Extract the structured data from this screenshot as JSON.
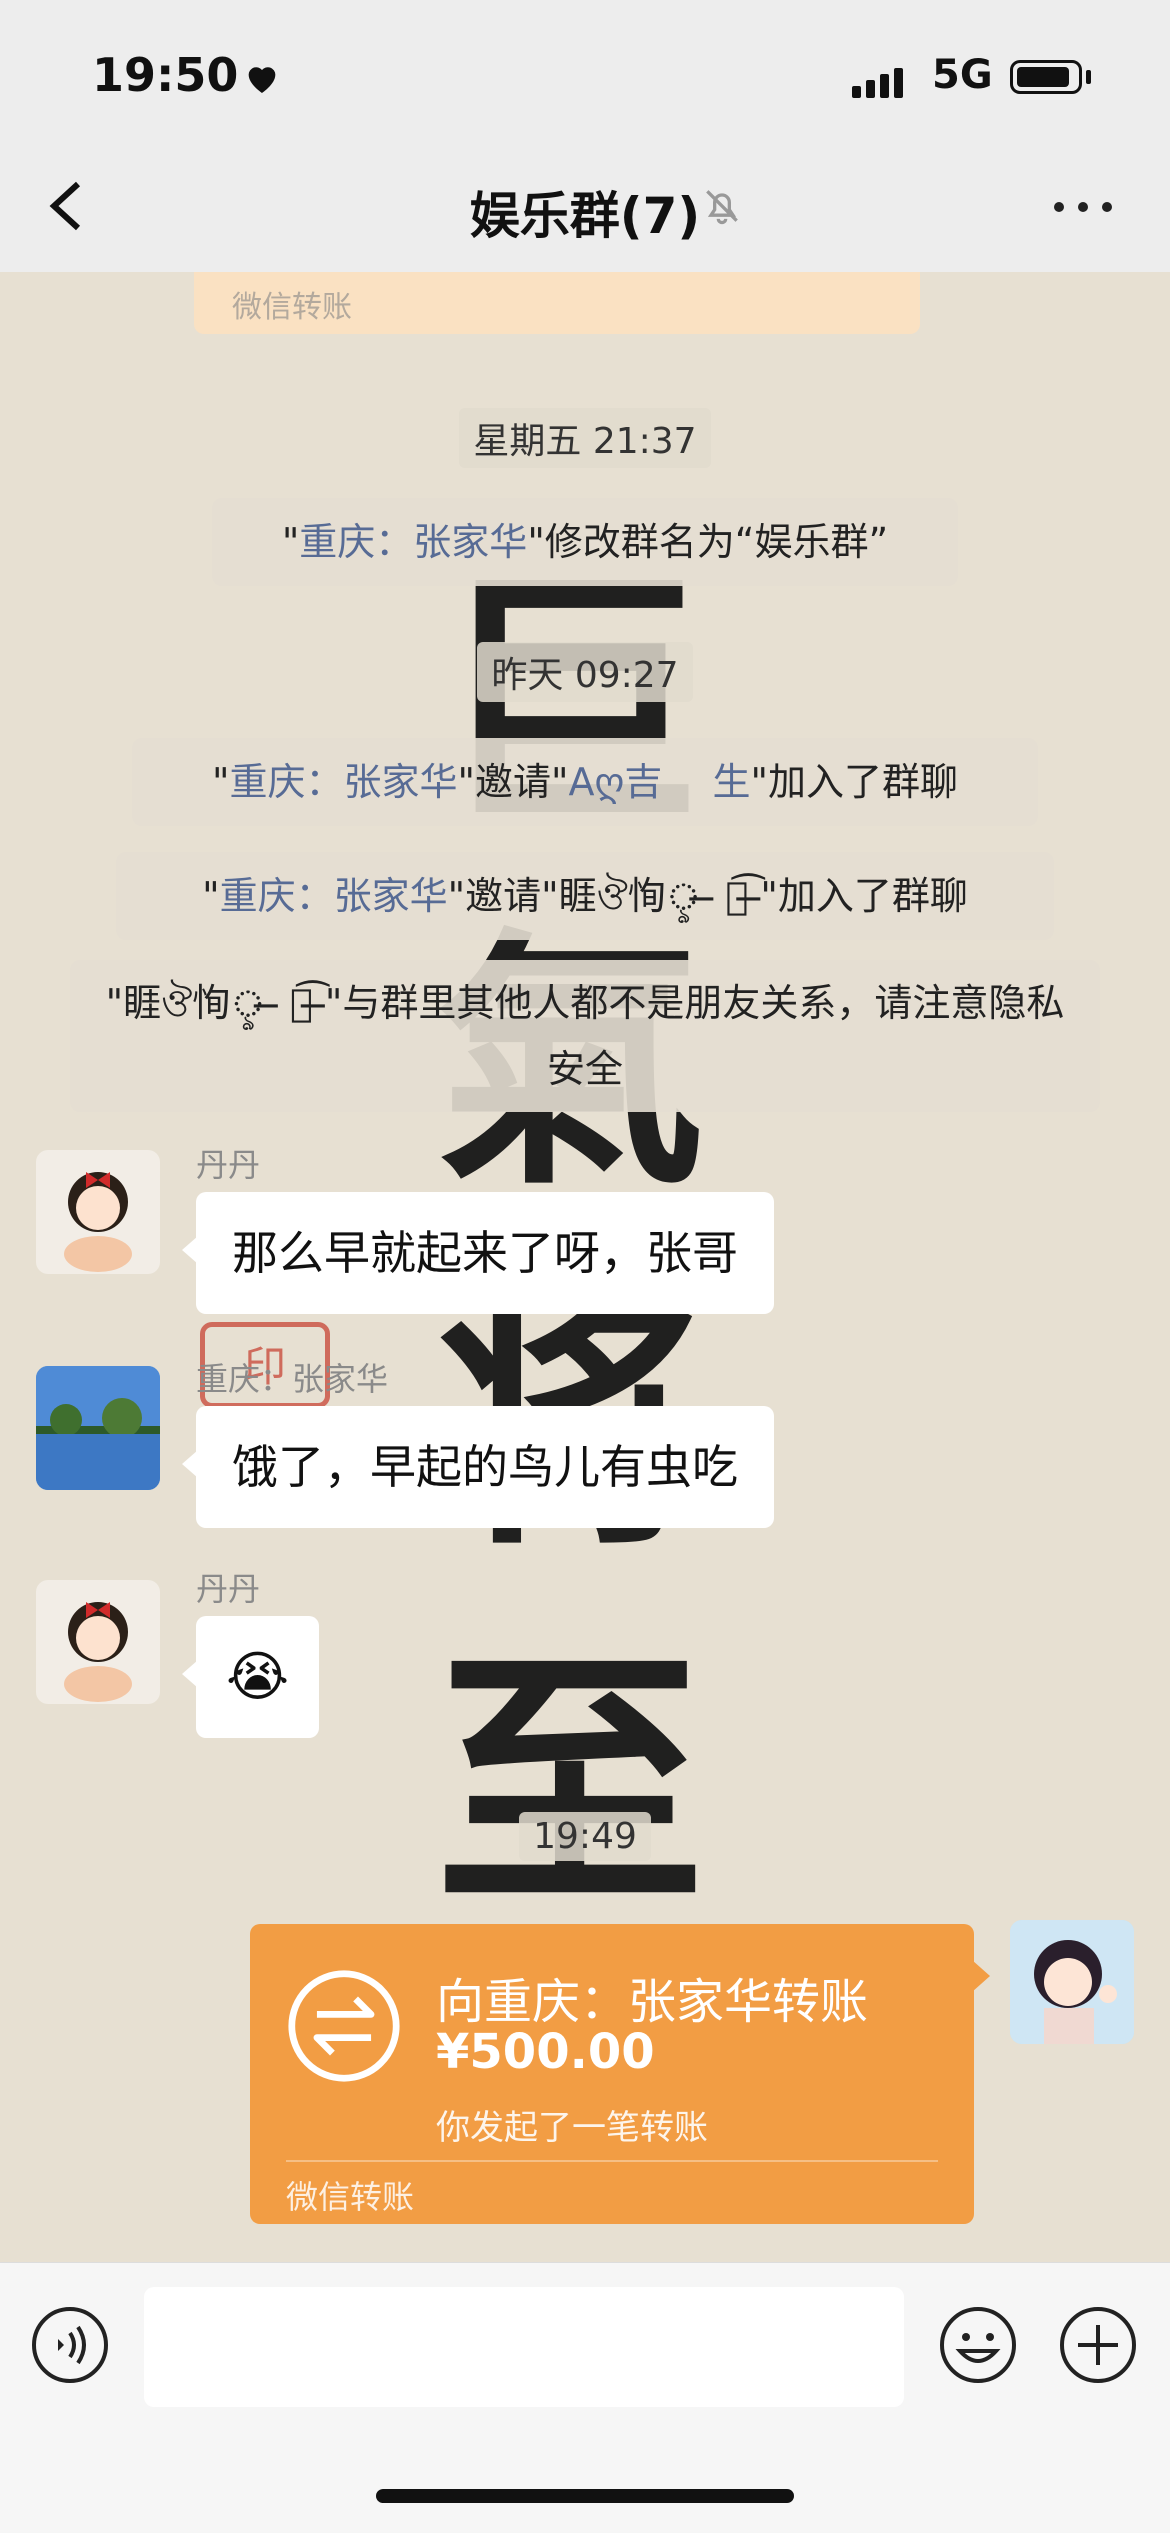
{
  "status": {
    "time": "19:50",
    "network": "5G"
  },
  "nav": {
    "title": "娱乐群(7)"
  },
  "chat": {
    "peek_label": "微信转账",
    "ts1": "星期五 21:37",
    "sys1": {
      "q1": "\"",
      "name": "重庆：张家华",
      "q2": "\"",
      "text": "修改群名为“娱乐群”"
    },
    "ts2": "昨天 09:27",
    "sys2": {
      "q1": "\"",
      "inviter": "重庆：张家华",
      "mid": "\"邀请\"",
      "invitee": "Aღ吉　 生",
      "end": "\"加入了群聊"
    },
    "sys3": {
      "q1": "\"",
      "inviter": "重庆：张家华",
      "mid": "\"邀请\"",
      "invitee": "睚ঔ恂ৢ ̶ ั͡ ̶",
      "end": "\"加入了群聊"
    },
    "sys4": {
      "text": "\"睚ঔ恂ৢ ̶ ั͡ ̶\"与群里其他人都不是朋友关系，请注意隐私安全"
    },
    "messages": [
      {
        "sender": "丹丹",
        "text": "那么早就起来了呀，张哥"
      },
      {
        "sender": "重庆：张家华",
        "text": "饿了，早起的鸟儿有虫吃"
      },
      {
        "sender": "丹丹",
        "text": "😭"
      }
    ],
    "ts3": "19:49",
    "transfer": {
      "title": "向重庆：张家华转账",
      "amount": "¥500.00",
      "subtitle": "你发起了一笔转账",
      "footer": "微信转账",
      "color": "#f29d44"
    }
  }
}
